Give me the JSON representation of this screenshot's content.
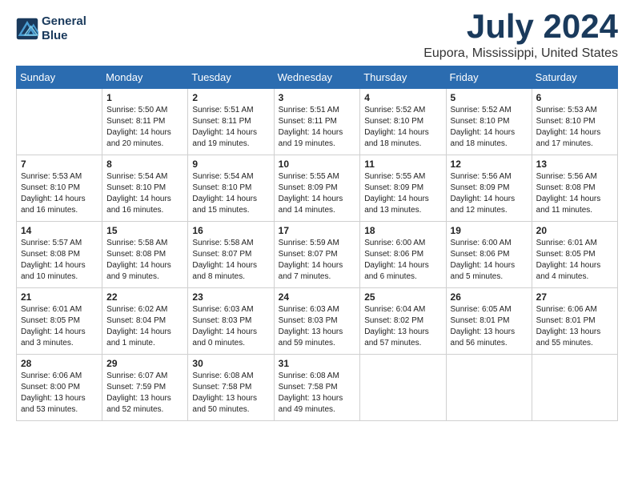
{
  "logo": {
    "line1": "General",
    "line2": "Blue"
  },
  "title": "July 2024",
  "subtitle": "Eupora, Mississippi, United States",
  "days_of_week": [
    "Sunday",
    "Monday",
    "Tuesday",
    "Wednesday",
    "Thursday",
    "Friday",
    "Saturday"
  ],
  "weeks": [
    [
      {
        "day": "",
        "info": ""
      },
      {
        "day": "1",
        "info": "Sunrise: 5:50 AM\nSunset: 8:11 PM\nDaylight: 14 hours\nand 20 minutes."
      },
      {
        "day": "2",
        "info": "Sunrise: 5:51 AM\nSunset: 8:11 PM\nDaylight: 14 hours\nand 19 minutes."
      },
      {
        "day": "3",
        "info": "Sunrise: 5:51 AM\nSunset: 8:11 PM\nDaylight: 14 hours\nand 19 minutes."
      },
      {
        "day": "4",
        "info": "Sunrise: 5:52 AM\nSunset: 8:10 PM\nDaylight: 14 hours\nand 18 minutes."
      },
      {
        "day": "5",
        "info": "Sunrise: 5:52 AM\nSunset: 8:10 PM\nDaylight: 14 hours\nand 18 minutes."
      },
      {
        "day": "6",
        "info": "Sunrise: 5:53 AM\nSunset: 8:10 PM\nDaylight: 14 hours\nand 17 minutes."
      }
    ],
    [
      {
        "day": "7",
        "info": "Sunrise: 5:53 AM\nSunset: 8:10 PM\nDaylight: 14 hours\nand 16 minutes."
      },
      {
        "day": "8",
        "info": "Sunrise: 5:54 AM\nSunset: 8:10 PM\nDaylight: 14 hours\nand 16 minutes."
      },
      {
        "day": "9",
        "info": "Sunrise: 5:54 AM\nSunset: 8:10 PM\nDaylight: 14 hours\nand 15 minutes."
      },
      {
        "day": "10",
        "info": "Sunrise: 5:55 AM\nSunset: 8:09 PM\nDaylight: 14 hours\nand 14 minutes."
      },
      {
        "day": "11",
        "info": "Sunrise: 5:55 AM\nSunset: 8:09 PM\nDaylight: 14 hours\nand 13 minutes."
      },
      {
        "day": "12",
        "info": "Sunrise: 5:56 AM\nSunset: 8:09 PM\nDaylight: 14 hours\nand 12 minutes."
      },
      {
        "day": "13",
        "info": "Sunrise: 5:56 AM\nSunset: 8:08 PM\nDaylight: 14 hours\nand 11 minutes."
      }
    ],
    [
      {
        "day": "14",
        "info": "Sunrise: 5:57 AM\nSunset: 8:08 PM\nDaylight: 14 hours\nand 10 minutes."
      },
      {
        "day": "15",
        "info": "Sunrise: 5:58 AM\nSunset: 8:08 PM\nDaylight: 14 hours\nand 9 minutes."
      },
      {
        "day": "16",
        "info": "Sunrise: 5:58 AM\nSunset: 8:07 PM\nDaylight: 14 hours\nand 8 minutes."
      },
      {
        "day": "17",
        "info": "Sunrise: 5:59 AM\nSunset: 8:07 PM\nDaylight: 14 hours\nand 7 minutes."
      },
      {
        "day": "18",
        "info": "Sunrise: 6:00 AM\nSunset: 8:06 PM\nDaylight: 14 hours\nand 6 minutes."
      },
      {
        "day": "19",
        "info": "Sunrise: 6:00 AM\nSunset: 8:06 PM\nDaylight: 14 hours\nand 5 minutes."
      },
      {
        "day": "20",
        "info": "Sunrise: 6:01 AM\nSunset: 8:05 PM\nDaylight: 14 hours\nand 4 minutes."
      }
    ],
    [
      {
        "day": "21",
        "info": "Sunrise: 6:01 AM\nSunset: 8:05 PM\nDaylight: 14 hours\nand 3 minutes."
      },
      {
        "day": "22",
        "info": "Sunrise: 6:02 AM\nSunset: 8:04 PM\nDaylight: 14 hours\nand 1 minute."
      },
      {
        "day": "23",
        "info": "Sunrise: 6:03 AM\nSunset: 8:03 PM\nDaylight: 14 hours\nand 0 minutes."
      },
      {
        "day": "24",
        "info": "Sunrise: 6:03 AM\nSunset: 8:03 PM\nDaylight: 13 hours\nand 59 minutes."
      },
      {
        "day": "25",
        "info": "Sunrise: 6:04 AM\nSunset: 8:02 PM\nDaylight: 13 hours\nand 57 minutes."
      },
      {
        "day": "26",
        "info": "Sunrise: 6:05 AM\nSunset: 8:01 PM\nDaylight: 13 hours\nand 56 minutes."
      },
      {
        "day": "27",
        "info": "Sunrise: 6:06 AM\nSunset: 8:01 PM\nDaylight: 13 hours\nand 55 minutes."
      }
    ],
    [
      {
        "day": "28",
        "info": "Sunrise: 6:06 AM\nSunset: 8:00 PM\nDaylight: 13 hours\nand 53 minutes."
      },
      {
        "day": "29",
        "info": "Sunrise: 6:07 AM\nSunset: 7:59 PM\nDaylight: 13 hours\nand 52 minutes."
      },
      {
        "day": "30",
        "info": "Sunrise: 6:08 AM\nSunset: 7:58 PM\nDaylight: 13 hours\nand 50 minutes."
      },
      {
        "day": "31",
        "info": "Sunrise: 6:08 AM\nSunset: 7:58 PM\nDaylight: 13 hours\nand 49 minutes."
      },
      {
        "day": "",
        "info": ""
      },
      {
        "day": "",
        "info": ""
      },
      {
        "day": "",
        "info": ""
      }
    ]
  ]
}
